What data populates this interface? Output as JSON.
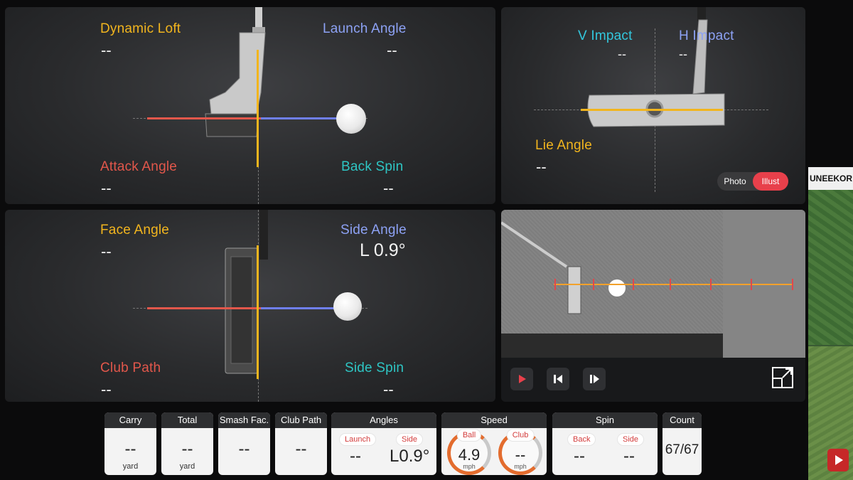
{
  "side_view": {
    "dynamic_loft": {
      "label": "Dynamic Loft",
      "value": "--"
    },
    "launch_angle": {
      "label": "Launch Angle",
      "value": "--"
    },
    "attack_angle": {
      "label": "Attack Angle",
      "value": "--"
    },
    "back_spin": {
      "label": "Back Spin",
      "value": "--"
    }
  },
  "front_view": {
    "v_impact": {
      "label": "V Impact",
      "value": "--"
    },
    "h_impact": {
      "label": "H Impact",
      "value": "--"
    },
    "lie_angle": {
      "label": "Lie Angle",
      "value": "--"
    },
    "toggle": {
      "photo": "Photo",
      "illust": "Illust",
      "selected": "Illust"
    }
  },
  "top_view": {
    "face_angle": {
      "label": "Face Angle",
      "value": "--"
    },
    "side_angle": {
      "label": "Side Angle",
      "value": "L 0.9°"
    },
    "club_path": {
      "label": "Club Path",
      "value": "--"
    },
    "side_spin": {
      "label": "Side Spin",
      "value": "--"
    }
  },
  "stats": {
    "carry": {
      "header": "Carry",
      "value": "--",
      "unit": "yard"
    },
    "total": {
      "header": "Total",
      "value": "--",
      "unit": "yard"
    },
    "smash": {
      "header": "Smash Fac.",
      "value": "--"
    },
    "club_path": {
      "header": "Club Path",
      "value": "--"
    },
    "angles": {
      "header": "Angles",
      "launch_label": "Launch",
      "launch_value": "--",
      "side_label": "Side",
      "side_value": "L0.9°"
    },
    "speed": {
      "header": "Speed",
      "ball_label": "Ball",
      "ball_value": "4.9",
      "ball_unit": "mph",
      "club_label": "Club",
      "club_value": "--",
      "club_unit": "mph"
    },
    "spin": {
      "header": "Spin",
      "back_label": "Back",
      "back_value": "--",
      "side_label": "Side",
      "side_value": "--"
    },
    "count": {
      "header": "Count",
      "value": "67/67"
    }
  },
  "external": {
    "title": "UNEEKOR"
  },
  "colors": {
    "yellow": "#f2b51e",
    "blue": "#8da2f5",
    "red": "#e2574b",
    "teal": "#2ec6c4",
    "accent": "#e8404b"
  }
}
